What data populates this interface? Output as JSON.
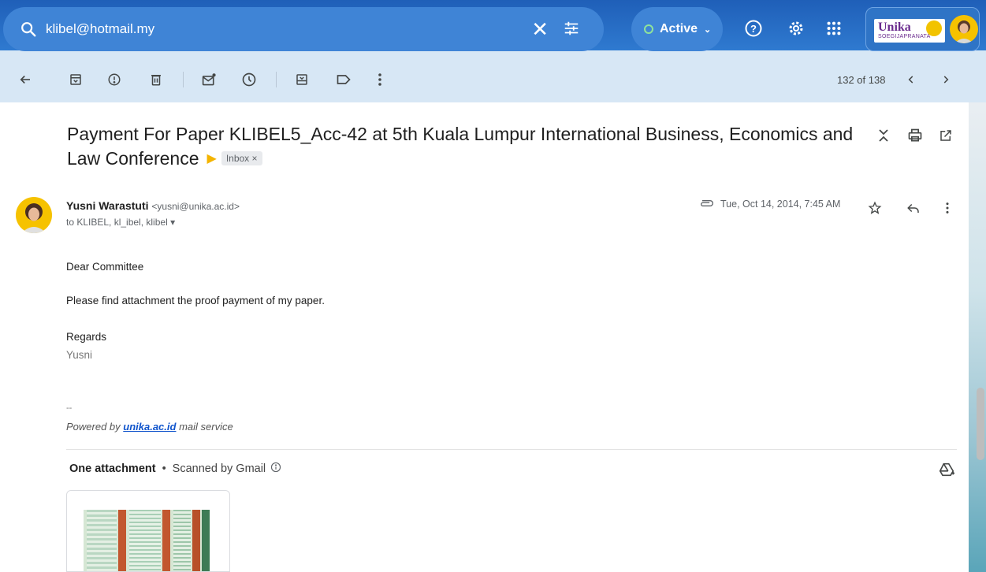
{
  "search": {
    "query": "klibel@hotmail.my"
  },
  "status": {
    "label": "Active"
  },
  "account": {
    "brand": "Unika",
    "brand_sub": "SOEGIJAPRANATA"
  },
  "pager": {
    "text": "132 of 138"
  },
  "email": {
    "subject": "Payment For Paper KLIBEL5_Acc-42 at 5th Kuala Lumpur International Business, Economics and Law Conference",
    "label": "Inbox",
    "sender_name": "Yusni Warastuti",
    "sender_email": "<yusni@unika.ac.id>",
    "recipients": "to KLIBEL, kl_ibel, klibel",
    "date": "Tue, Oct 14, 2014, 7:45 AM",
    "body": {
      "greeting": "Dear Committee",
      "line1": "Please find attachment the proof payment of my paper.",
      "closing": "Regards",
      "name": "Yusni",
      "sig_sep": "--",
      "powered_prefix": "Powered by ",
      "powered_link": "unika.ac.id",
      "powered_suffix": " mail service"
    },
    "attachments": {
      "title": "One attachment",
      "scanned": "Scanned by Gmail"
    }
  },
  "colors": {
    "top_bg": "#2f7ad0",
    "toolbar_bg": "#d7e7f5",
    "accent_link": "#1155cc",
    "important_marker": "#f4b400"
  },
  "icons": [
    "search-icon",
    "close-icon",
    "tune-icon",
    "help-icon",
    "settings-icon",
    "apps-icon",
    "back-icon",
    "archive-icon",
    "report-spam-icon",
    "delete-icon",
    "mark-unread-icon",
    "snooze-icon",
    "move-to-icon",
    "label-icon",
    "more-vert-icon",
    "chevron-left-icon",
    "chevron-right-icon",
    "expand-collapse-icon",
    "print-icon",
    "open-new-window-icon",
    "attachment-clip-icon",
    "star-icon",
    "reply-icon",
    "info-icon",
    "add-to-drive-icon"
  ]
}
